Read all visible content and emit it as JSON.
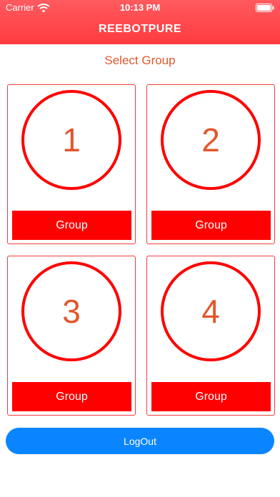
{
  "status_bar": {
    "carrier": "Carrier",
    "time": "10:13 PM"
  },
  "nav": {
    "title": "REEBOTPURE"
  },
  "page": {
    "subtitle": "Select Group"
  },
  "groups": [
    {
      "number": "1",
      "button_label": "Group"
    },
    {
      "number": "2",
      "button_label": "Group"
    },
    {
      "number": "3",
      "button_label": "Group"
    },
    {
      "number": "4",
      "button_label": "Group"
    }
  ],
  "actions": {
    "logout_label": "LogOut"
  },
  "colors": {
    "header": "#ff4a4d",
    "accent_red": "#ff0000",
    "text_orange": "#e2572c",
    "logout_blue": "#0b85ff"
  },
  "icons": [
    "wifi-icon",
    "battery-icon"
  ]
}
